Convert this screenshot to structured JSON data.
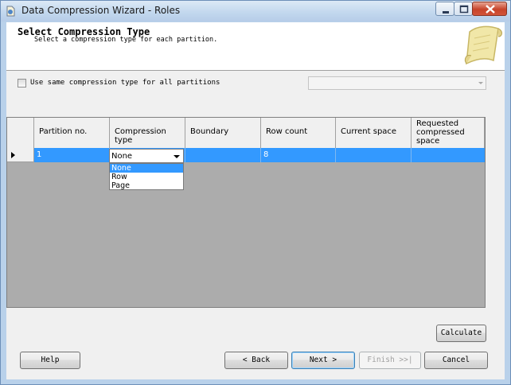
{
  "window": {
    "title": "Data Compression Wizard - Roles"
  },
  "header": {
    "title": "Select Compression Type",
    "subtitle": "Select a compression type for each partition."
  },
  "options": {
    "same_type_label": "Use same compression type for all partitions",
    "same_type_checked": false,
    "same_type_combo_value": ""
  },
  "grid": {
    "columns": [
      "Partition no.",
      "Compression type",
      "Boundary",
      "Row count",
      "Current space",
      "Requested compressed space"
    ],
    "rows": [
      {
        "partition": "1",
        "compression": "None",
        "boundary": "",
        "row_count": "8",
        "current_space": "",
        "requested_space": ""
      }
    ]
  },
  "dropdown": {
    "value": "None",
    "options": [
      "None",
      "Row",
      "Page"
    ],
    "selected_index": 0
  },
  "buttons": {
    "calculate": "Calculate",
    "help": "Help",
    "back": "< Back",
    "next": "Next >",
    "finish": "Finish >>|",
    "cancel": "Cancel"
  },
  "colors": {
    "selection": "#3399ff",
    "titlebar": "#c3d8ee",
    "close": "#c7442a"
  }
}
